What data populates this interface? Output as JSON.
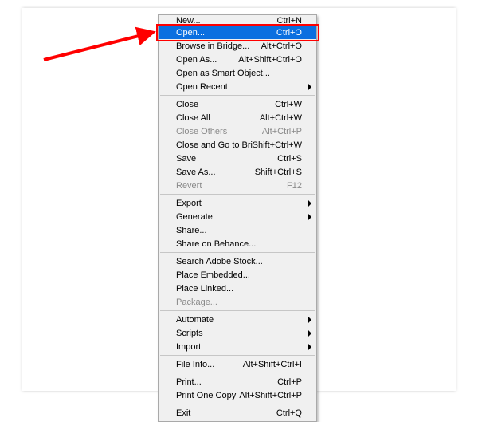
{
  "menu": {
    "groups": [
      [
        {
          "id": "new",
          "label": "New...",
          "shortcut": "Ctrl+N",
          "disabled": false,
          "submenu": false,
          "selected": false,
          "cutTop": true
        },
        {
          "id": "open",
          "label": "Open...",
          "shortcut": "Ctrl+O",
          "disabled": false,
          "submenu": false,
          "selected": true
        },
        {
          "id": "browse-in-bridge",
          "label": "Browse in Bridge...",
          "shortcut": "Alt+Ctrl+O",
          "disabled": false,
          "submenu": false
        },
        {
          "id": "open-as",
          "label": "Open As...",
          "shortcut": "Alt+Shift+Ctrl+O",
          "disabled": false,
          "submenu": false
        },
        {
          "id": "open-as-smart-object",
          "label": "Open as Smart Object...",
          "shortcut": "",
          "disabled": false,
          "submenu": false
        },
        {
          "id": "open-recent",
          "label": "Open Recent",
          "shortcut": "",
          "disabled": false,
          "submenu": true
        }
      ],
      [
        {
          "id": "close",
          "label": "Close",
          "shortcut": "Ctrl+W",
          "disabled": false,
          "submenu": false
        },
        {
          "id": "close-all",
          "label": "Close All",
          "shortcut": "Alt+Ctrl+W",
          "disabled": false,
          "submenu": false
        },
        {
          "id": "close-others",
          "label": "Close Others",
          "shortcut": "Alt+Ctrl+P",
          "disabled": true,
          "submenu": false
        },
        {
          "id": "close-and-go-to-bridge",
          "label": "Close and Go to Bridge...",
          "shortcut": "Shift+Ctrl+W",
          "disabled": false,
          "submenu": false
        },
        {
          "id": "save",
          "label": "Save",
          "shortcut": "Ctrl+S",
          "disabled": false,
          "submenu": false
        },
        {
          "id": "save-as",
          "label": "Save As...",
          "shortcut": "Shift+Ctrl+S",
          "disabled": false,
          "submenu": false
        },
        {
          "id": "revert",
          "label": "Revert",
          "shortcut": "F12",
          "disabled": true,
          "submenu": false
        }
      ],
      [
        {
          "id": "export",
          "label": "Export",
          "shortcut": "",
          "disabled": false,
          "submenu": true
        },
        {
          "id": "generate",
          "label": "Generate",
          "shortcut": "",
          "disabled": false,
          "submenu": true
        },
        {
          "id": "share",
          "label": "Share...",
          "shortcut": "",
          "disabled": false,
          "submenu": false
        },
        {
          "id": "share-on-behance",
          "label": "Share on Behance...",
          "shortcut": "",
          "disabled": false,
          "submenu": false
        }
      ],
      [
        {
          "id": "search-adobe-stock",
          "label": "Search Adobe Stock...",
          "shortcut": "",
          "disabled": false,
          "submenu": false
        },
        {
          "id": "place-embedded",
          "label": "Place Embedded...",
          "shortcut": "",
          "disabled": false,
          "submenu": false
        },
        {
          "id": "place-linked",
          "label": "Place Linked...",
          "shortcut": "",
          "disabled": false,
          "submenu": false
        },
        {
          "id": "package",
          "label": "Package...",
          "shortcut": "",
          "disabled": true,
          "submenu": false
        }
      ],
      [
        {
          "id": "automate",
          "label": "Automate",
          "shortcut": "",
          "disabled": false,
          "submenu": true
        },
        {
          "id": "scripts",
          "label": "Scripts",
          "shortcut": "",
          "disabled": false,
          "submenu": true
        },
        {
          "id": "import",
          "label": "Import",
          "shortcut": "",
          "disabled": false,
          "submenu": true
        }
      ],
      [
        {
          "id": "file-info",
          "label": "File Info...",
          "shortcut": "Alt+Shift+Ctrl+I",
          "disabled": false,
          "submenu": false
        }
      ],
      [
        {
          "id": "print",
          "label": "Print...",
          "shortcut": "Ctrl+P",
          "disabled": false,
          "submenu": false
        },
        {
          "id": "print-one-copy",
          "label": "Print One Copy",
          "shortcut": "Alt+Shift+Ctrl+P",
          "disabled": false,
          "submenu": false
        }
      ],
      [
        {
          "id": "exit",
          "label": "Exit",
          "shortcut": "Ctrl+Q",
          "disabled": false,
          "submenu": false
        }
      ]
    ]
  },
  "callout": {
    "targetId": "open",
    "arrowColor": "#ff0000"
  }
}
